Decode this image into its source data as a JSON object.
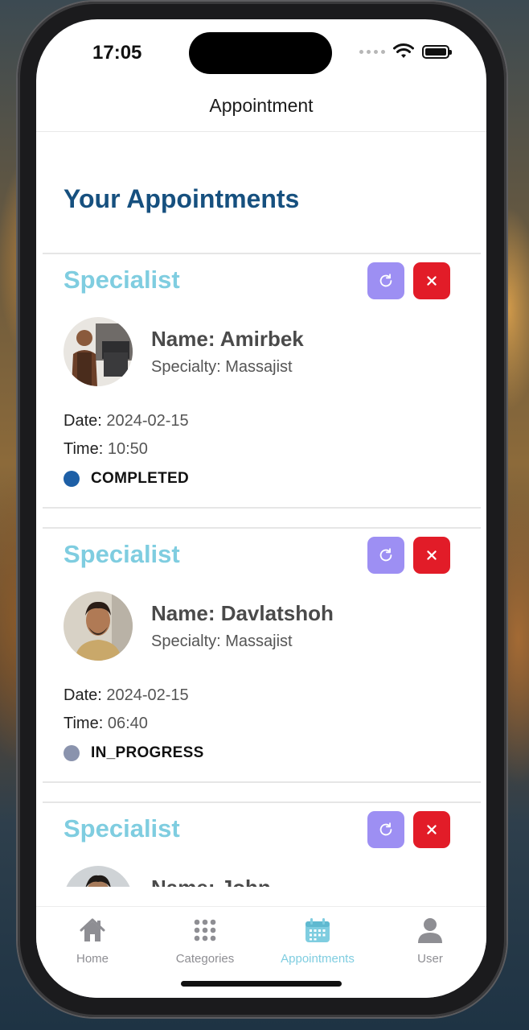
{
  "status_bar": {
    "time": "17:05"
  },
  "header": {
    "title": "Appointment"
  },
  "page": {
    "heading": "Your Appointments"
  },
  "appointments": [
    {
      "section_title": "Specialist",
      "name": "Name: Amirbek",
      "specialty": "Specialty: Massajist",
      "date_label": "Date:",
      "date": "2024-02-15",
      "time_label": "Time:",
      "time": "10:50",
      "status": "COMPLETED",
      "status_color": "#1d5fa6"
    },
    {
      "section_title": "Specialist",
      "name": "Name: Davlatshoh",
      "specialty": "Specialty: Massajist",
      "date_label": "Date:",
      "date": "2024-02-15",
      "time_label": "Time:",
      "time": "06:40",
      "status": "IN_PROGRESS",
      "status_color": "#8a93ad"
    },
    {
      "section_title": "Specialist",
      "name": "Name: John"
    }
  ],
  "tabs": [
    {
      "label": "Home",
      "icon": "home-icon",
      "active": false
    },
    {
      "label": "Categories",
      "icon": "grid-icon",
      "active": false
    },
    {
      "label": "Appointments",
      "icon": "calendar-icon",
      "active": true
    },
    {
      "label": "User",
      "icon": "user-icon",
      "active": false
    }
  ],
  "colors": {
    "heading": "#16507f",
    "section_title": "#7fcde0",
    "refresh_button": "#9d8ff3",
    "cancel_button": "#e21c28",
    "active_tab": "#7fcde0",
    "inactive_tab": "#8e8e93"
  }
}
